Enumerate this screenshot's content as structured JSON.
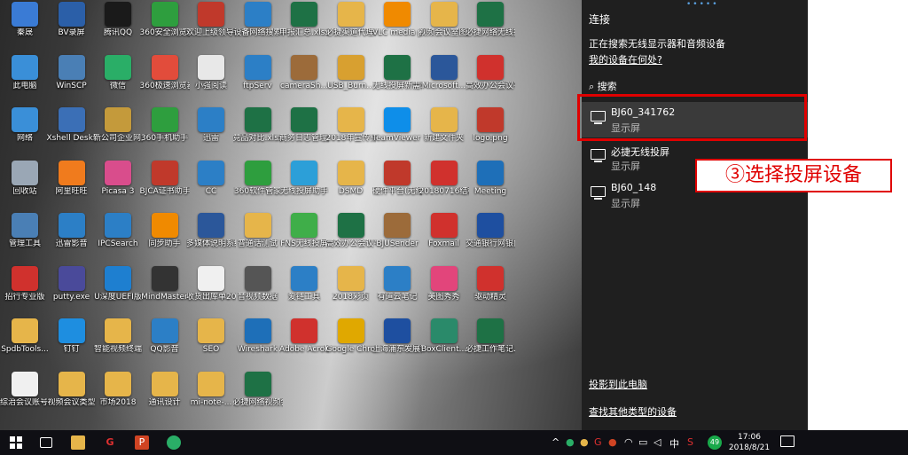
{
  "desktop_icons": [
    {
      "label": "秦晟",
      "icon": "user-icon",
      "color": "#3a7bd5"
    },
    {
      "label": "BV录屏",
      "icon": "recorder-icon",
      "color": "#2b5fa8"
    },
    {
      "label": "腾讯QQ",
      "icon": "qq-icon",
      "color": "#1a1a1a"
    },
    {
      "label": "360安全浏览器",
      "icon": "browser-360-icon",
      "color": "#2e9e3e"
    },
    {
      "label": "欢迎上级领导莅临指导pp...",
      "icon": "pptx-file-icon",
      "color": "#c0392b"
    },
    {
      "label": "设备网络搜索",
      "icon": "network-search-icon",
      "color": "#2c7fc6"
    },
    {
      "label": "申报汇总.xlsx",
      "icon": "xlsx-file-icon",
      "color": "#1e7145"
    },
    {
      "label": "必捷渠道代理...",
      "icon": "folder-icon",
      "color": "#e6b54a"
    },
    {
      "label": "VLC media player",
      "icon": "vlc-icon",
      "color": "#f08a00"
    },
    {
      "label": "视频会议室图片",
      "icon": "folder-icon",
      "color": "#e6b54a"
    },
    {
      "label": "必捷网络无线投屏SDK版...",
      "icon": "xlsx-file-icon",
      "color": "#1e7145"
    },
    {
      "label": "此电脑",
      "icon": "computer-icon",
      "color": "#3a8fd8"
    },
    {
      "label": "WinSCP",
      "icon": "winscp-icon",
      "color": "#4a7fb5"
    },
    {
      "label": "微信",
      "icon": "wechat-icon",
      "color": "#2aae67"
    },
    {
      "label": "360极速浏览器",
      "icon": "browser-360-fast-icon",
      "color": "#e24c3b"
    },
    {
      "label": "小强阅读",
      "icon": "reader-icon",
      "color": "#e8e8e8"
    },
    {
      "label": "ftpServ",
      "icon": "ftp-icon",
      "color": "#2c7fc6"
    },
    {
      "label": "cameraSh...",
      "icon": "apk-file-icon",
      "color": "#9c6b3a"
    },
    {
      "label": "USB_Burn...",
      "icon": "usb-burn-icon",
      "color": "#d8a030"
    },
    {
      "label": "无线投屏新需求.xlsx",
      "icon": "xlsx-file-icon",
      "color": "#1e7145"
    },
    {
      "label": "Microsoft...",
      "icon": "word-file-icon",
      "color": "#2b579a"
    },
    {
      "label": "高效办公会议平台-样稿.p",
      "icon": "pdf-file-icon",
      "color": "#d0312d"
    },
    {
      "label": "网络",
      "icon": "network-icon",
      "color": "#3a8fd8"
    },
    {
      "label": "Xshell Desktop",
      "icon": "xshell-icon",
      "color": "#3b6fb6"
    },
    {
      "label": "新公司企业网上申报服务系统",
      "icon": "tax-system-icon",
      "color": "#c49a3b"
    },
    {
      "label": "360手机助手",
      "icon": "phone-assistant-icon",
      "color": "#2e9e3e"
    },
    {
      "label": "迅雷",
      "icon": "thunder-icon",
      "color": "#2c7fc6"
    },
    {
      "label": "竞品对比.xlsx",
      "icon": "xlsx-file-icon",
      "color": "#1e7145"
    },
    {
      "label": "商务日志管理汇总.xlsx",
      "icon": "xlsx-file-icon",
      "color": "#1e7145"
    },
    {
      "label": "2018年宣传点... ",
      "icon": "folder-icon",
      "color": "#e6b54a"
    },
    {
      "label": "TeamViewer 13",
      "icon": "teamviewer-icon",
      "color": "#0e8ee9"
    },
    {
      "label": "新建文件夹",
      "icon": "folder-icon",
      "color": "#e6b54a"
    },
    {
      "label": "logo.png",
      "icon": "image-file-icon",
      "color": "#c0392b"
    },
    {
      "label": "回收站",
      "icon": "recycle-bin-icon",
      "color": "#9aa7b5"
    },
    {
      "label": "阿里旺旺",
      "icon": "aliwangwang-icon",
      "color": "#f07b1d"
    },
    {
      "label": "Picasa 3",
      "icon": "picasa-icon",
      "color": "#d94d8c"
    },
    {
      "label": "BJCA证书助手",
      "icon": "cert-icon",
      "color": "#c0392b"
    },
    {
      "label": "CC",
      "icon": "cc-icon",
      "color": "#2c7fc6"
    },
    {
      "label": "360软件管家",
      "icon": "software-manager-icon",
      "color": "#2e9e3e"
    },
    {
      "label": "无线投屏助手",
      "icon": "link-icon",
      "color": "#2c9fd8"
    },
    {
      "label": "DSMD",
      "icon": "folder-icon",
      "color": "#e6b54a"
    },
    {
      "label": "硬件平台(无线投屏)",
      "icon": "hardware-icon",
      "color": "#c0392b"
    },
    {
      "label": "20180716结构(3).pdf",
      "icon": "pdf-file-icon",
      "color": "#d0312d"
    },
    {
      "label": "Meeting",
      "icon": "meeting-icon",
      "color": "#1e6fb8"
    },
    {
      "label": "管理工具",
      "icon": "tools-icon",
      "color": "#4a7fb5"
    },
    {
      "label": "迅雷影音",
      "icon": "thunder-player-icon",
      "color": "#2c7fc6"
    },
    {
      "label": "IPCSearch",
      "icon": "ipc-search-icon",
      "color": "#2c7fc6"
    },
    {
      "label": "同步助手",
      "icon": "sync-icon",
      "color": "#f08a00"
    },
    {
      "label": "多媒体说明系统用户手册",
      "icon": "word-file-icon",
      "color": "#2b579a"
    },
    {
      "label": "普通话测试",
      "icon": "folder-icon",
      "color": "#e6b54a"
    },
    {
      "label": "FNS无线投屏",
      "icon": "fn-icon",
      "color": "#3fae49"
    },
    {
      "label": "高效办公会议平台",
      "icon": "xlsx-file-icon",
      "color": "#1e7145"
    },
    {
      "label": "BJUSender",
      "icon": "apk-file-icon",
      "color": "#9c6b3a"
    },
    {
      "label": "Foxmail",
      "icon": "foxmail-icon",
      "color": "#d0312d"
    },
    {
      "label": "交通银行网银向导",
      "icon": "bank-icon",
      "color": "#1e4fa0"
    },
    {
      "label": "招行专业版",
      "icon": "cmb-icon",
      "color": "#d0312d"
    },
    {
      "label": "putty.exe",
      "icon": "putty-icon",
      "color": "#4a4a9a"
    },
    {
      "label": "U深度UEFI版",
      "icon": "udisk-icon",
      "color": "#1e7fd0"
    },
    {
      "label": "MindMaster",
      "icon": "mindmaster-icon",
      "color": "#333333"
    },
    {
      "label": "收货出库单2018.xlsx",
      "icon": "mail-file-icon",
      "color": "#f0f0f0"
    },
    {
      "label": "音视频数据",
      "icon": "vko-icon",
      "color": "#555555"
    },
    {
      "label": "爱链工具",
      "icon": "tool-link-icon",
      "color": "#2c7fc6"
    },
    {
      "label": "2018彩页",
      "icon": "folder-icon",
      "color": "#e6b54a"
    },
    {
      "label": "有道云笔记",
      "icon": "youdao-note-icon",
      "color": "#2c7fc6"
    },
    {
      "label": "美图秀秀",
      "icon": "meitu-icon",
      "color": "#e2457b"
    },
    {
      "label": "驱动精灵",
      "icon": "driver-icon",
      "color": "#d0312d"
    },
    {
      "label": "SpdbTools...",
      "icon": "spdb-tools-icon",
      "color": "#e6b54a"
    },
    {
      "label": "钉钉",
      "icon": "dingtalk-icon",
      "color": "#1e8ee0"
    },
    {
      "label": "智能视频终端",
      "icon": "folder-icon",
      "color": "#e6b54a"
    },
    {
      "label": "QQ影音",
      "icon": "qq-player-icon",
      "color": "#2c7fc6"
    },
    {
      "label": "SEO",
      "icon": "folder-icon",
      "color": "#e6b54a"
    },
    {
      "label": "Wireshark",
      "icon": "wireshark-icon",
      "color": "#1e6fb8"
    },
    {
      "label": "Adobe Acrobat...",
      "icon": "acrobat-icon",
      "color": "#d0312d"
    },
    {
      "label": "Google Chrome",
      "icon": "chrome-icon",
      "color": "#e0a800"
    },
    {
      "label": "上海浦东发展银行网银管家",
      "icon": "bank-icon",
      "color": "#1e4fa0"
    },
    {
      "label": "BoxClient...",
      "icon": "box-client-icon",
      "color": "#2a8a6a"
    },
    {
      "label": "必捷工作笔记.xlsx",
      "icon": "xlsx-file-icon",
      "color": "#1e7145"
    },
    {
      "label": "综治会议账号.txt",
      "icon": "txt-file-icon",
      "color": "#f0f0f0"
    },
    {
      "label": "视频会议类型",
      "icon": "folder-icon",
      "color": "#e6b54a"
    },
    {
      "label": "市场2018",
      "icon": "folder-icon",
      "color": "#e6b54a"
    },
    {
      "label": "通讯设计",
      "icon": "folder-icon",
      "color": "#e6b54a"
    },
    {
      "label": "mi-note-...",
      "icon": "folder-icon",
      "color": "#e6b54a"
    },
    {
      "label": "必捷网络视频会议系统报...",
      "icon": "xlsx-file-icon",
      "color": "#1e7145"
    }
  ],
  "connect_panel": {
    "title": "连接",
    "searching": "正在搜索无线显示器和音频设备",
    "where_link": "我的设备在何处?",
    "search_label": "搜索",
    "devices": [
      {
        "name": "BJ60_341762",
        "type": "显示屏",
        "selected": true
      },
      {
        "name": "必捷无线投屏",
        "type": "显示屏",
        "selected": false
      },
      {
        "name": "BJ60_148",
        "type": "显示屏",
        "selected": false
      }
    ],
    "project_link": "投影到此电脑",
    "other_devices_link": "查找其他类型的设备"
  },
  "annotation": {
    "text": "③选择投屏设备",
    "color": "#e00000"
  },
  "taskbar": {
    "clock_time": "17:06",
    "clock_date": "2018/8/21",
    "ime_label": "中",
    "badge": "49"
  }
}
